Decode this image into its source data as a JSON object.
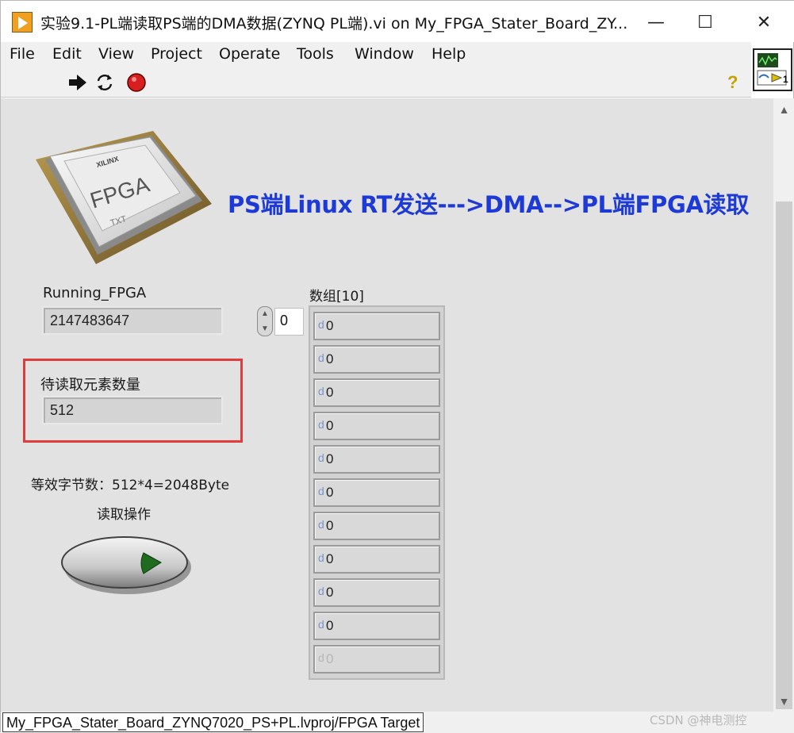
{
  "window": {
    "title": "实验9.1-PL端读取PS端的DMA数据(ZYNQ PL端).vi on My_FPGA_Stater_Board_ZY...",
    "minimize_glyph": "—",
    "maximize_glyph": "☐",
    "close_glyph": "✕"
  },
  "menu": [
    "File",
    "Edit",
    "View",
    "Project",
    "Operate",
    "Tools",
    "Window",
    "Help"
  ],
  "toolbar": {
    "icons": [
      "run-arrow-icon",
      "run-continuously-icon",
      "abort-stop-icon"
    ],
    "help_glyph": "?"
  },
  "vi_icon": {
    "badge": "1"
  },
  "panel": {
    "chip_label": "FPGA",
    "chip_brand": "XILINX",
    "chip_sub": "TXT",
    "heading": "PS端Linux RT发送--->DMA-->PL端FPGA读取",
    "running_fpga": {
      "label": "Running_FPGA",
      "value": "2147483647"
    },
    "pending": {
      "label": "待读取元素数量",
      "value": "512"
    },
    "equivalent_bytes": "等效字节数：512*4=2048Byte",
    "read_button_label": "读取操作",
    "array": {
      "label": "数组[10]",
      "index": "0",
      "elements": [
        "0",
        "0",
        "0",
        "0",
        "0",
        "0",
        "0",
        "0",
        "0",
        "0",
        "0"
      ],
      "type_glyph": "d"
    }
  },
  "status": {
    "path": "My_FPGA_Stater_Board_ZYNQ7020_PS+PL.lvproj/FPGA Target",
    "watermark": "CSDN @神电测控"
  },
  "colors": {
    "heading": "#1d3ad6",
    "highlight_box": "#e23b3b",
    "panel_bg": "#e2e2e2",
    "button_led": "#1f6b1f"
  }
}
